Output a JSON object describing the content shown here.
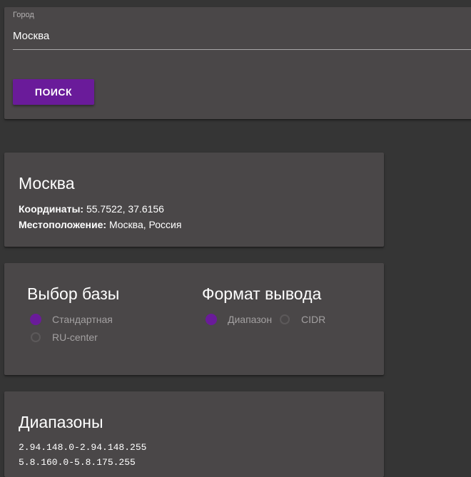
{
  "search": {
    "city_label": "Город",
    "city_value": "Москва",
    "search_button": "ПОИСК"
  },
  "location": {
    "city": "Москва",
    "coords_label": "Координаты",
    "coords_value": "55.7522, 37.6156",
    "place_label": "Местоположение",
    "place_value": "Москва, Россия"
  },
  "database": {
    "title": "Выбор базы",
    "options": [
      {
        "label": "Стандартная",
        "checked": true
      },
      {
        "label": "RU-center",
        "checked": false
      }
    ]
  },
  "format": {
    "title": "Формат вывода",
    "options": [
      {
        "label": "Диапазон",
        "checked": true
      },
      {
        "label": "CIDR",
        "checked": false
      }
    ]
  },
  "ranges": {
    "title": "Диапазоны",
    "items": [
      "2.94.148.0-2.94.148.255",
      "5.8.160.0-5.8.175.255"
    ]
  },
  "colors": {
    "background": "#353535",
    "card": "#4a4748",
    "accent": "#6a1b9a"
  }
}
